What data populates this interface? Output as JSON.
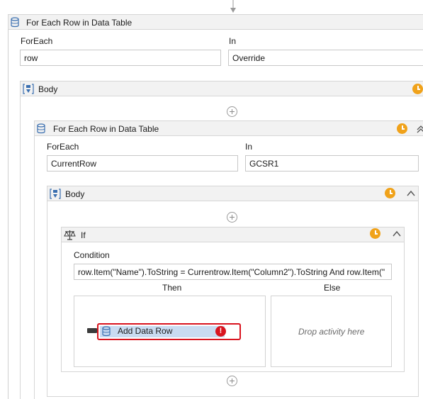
{
  "outer_foreach": {
    "title": "For Each Row in Data Table",
    "foreach_label": "ForEach",
    "foreach_value": "row",
    "in_label": "In",
    "in_value": "Override",
    "body_title": "Body"
  },
  "inner_foreach": {
    "title": "For Each Row in Data Table",
    "foreach_label": "ForEach",
    "foreach_value": "CurrentRow",
    "in_label": "In",
    "in_value": "GCSR1",
    "body_title": "Body"
  },
  "if_activity": {
    "title": "If",
    "condition_label": "Condition",
    "condition_value": "row.Item(\"Name\").ToString = Currentrow.Item(\"Column2\").ToString And row.Item(\"",
    "then_label": "Then",
    "else_label": "Else",
    "else_placeholder": "Drop activity here"
  },
  "add_data_row": {
    "label": "Add Data Row",
    "error_symbol": "!"
  },
  "colors": {
    "accent_clock": "#f0a21a",
    "error": "#d9141f",
    "selected_bg": "#c9dbf1"
  }
}
